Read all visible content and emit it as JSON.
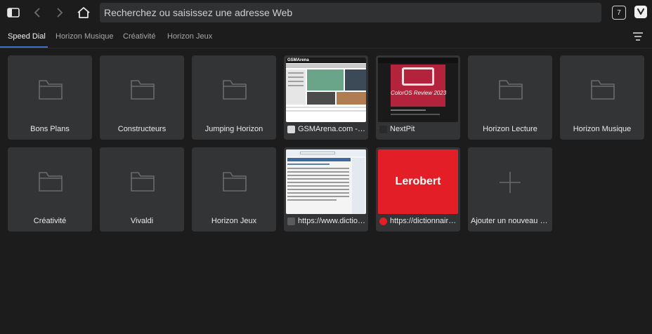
{
  "toolbar": {
    "address_placeholder": "Recherchez ou saisissez une adresse Web",
    "tab_count": "7"
  },
  "tabs": [
    {
      "label": "Speed Dial",
      "active": true
    },
    {
      "label": "Horizon Musique",
      "active": false
    },
    {
      "label": "Créativité",
      "active": false
    },
    {
      "label": "Horizon Jeux",
      "active": false
    }
  ],
  "tiles": [
    {
      "label": "Bons Plans",
      "type": "folder"
    },
    {
      "label": "Constructeurs",
      "type": "folder"
    },
    {
      "label": "Jumping Horizon",
      "type": "folder"
    },
    {
      "label": "GSMArena.com - m...",
      "type": "site"
    },
    {
      "label": "NextPit",
      "type": "site"
    },
    {
      "label": "Horizon Lecture",
      "type": "folder"
    },
    {
      "label": "Horizon Musique",
      "type": "folder"
    },
    {
      "label": "Créativité",
      "type": "folder"
    },
    {
      "label": "Vivaldi",
      "type": "folder"
    },
    {
      "label": "Horizon Jeux",
      "type": "folder"
    },
    {
      "label": "https://www.diction...",
      "type": "site"
    },
    {
      "label": "https://dictionnaire....",
      "type": "site"
    },
    {
      "label": "Ajouter un nouveau Spe...",
      "type": "add"
    }
  ],
  "thumbs": {
    "lerobert_logo": "Lerobert",
    "gsmarena_logo": "GSMArena",
    "nextpit_banner": "ColorOS Review 2023"
  },
  "colors": {
    "background": "#1c1c1d",
    "tile": "#333436",
    "accent": "#3f74c2",
    "lerobert_red": "#e41e26"
  }
}
